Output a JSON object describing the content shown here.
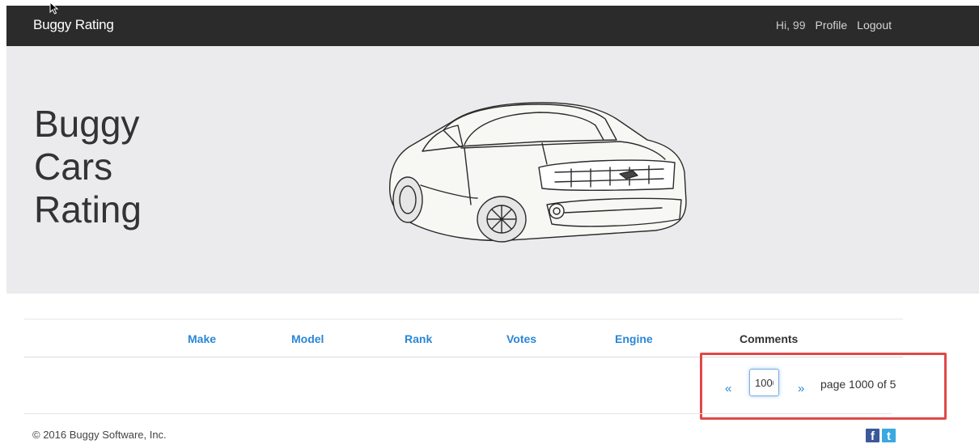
{
  "navbar": {
    "brand": "Buggy Rating",
    "greeting": "Hi, 99",
    "profile_label": "Profile",
    "logout_label": "Logout"
  },
  "hero": {
    "title_line1": "Buggy",
    "title_line2": "Cars",
    "title_line3": "Rating"
  },
  "table": {
    "columns": [
      "Make",
      "Model",
      "Rank",
      "Votes",
      "Engine",
      "Comments"
    ]
  },
  "pagination": {
    "prev_symbol": "«",
    "next_symbol": "»",
    "page_input_value": "1000",
    "page_text": "page 1000 of 5"
  },
  "footer": {
    "copyright": "© 2016 Buggy Software, Inc."
  },
  "colors": {
    "navbar_bg": "#2b2b2b",
    "hero_bg": "#ebebed",
    "link_blue": "#2a86d6",
    "highlight_red": "#e04848"
  }
}
